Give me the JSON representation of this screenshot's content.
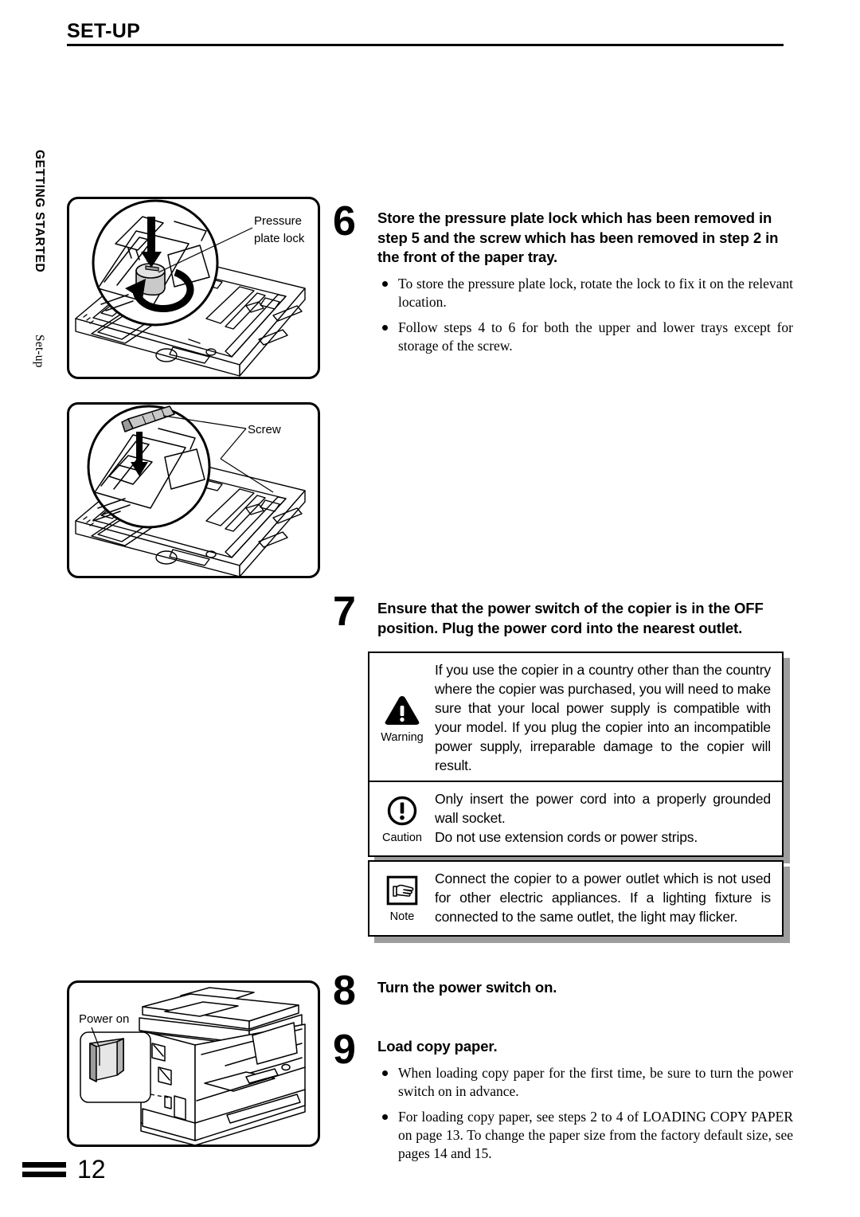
{
  "header": {
    "title": "SET-UP"
  },
  "side_tab": {
    "chapter": "GETTING STARTED",
    "section": "Set-up"
  },
  "figures": [
    {
      "id": "tray-lock",
      "name": "paper-tray-pressure-plate-lock-figure",
      "callout": "Pressure plate lock",
      "callout_line1": "Pressure",
      "callout_line2": "plate lock"
    },
    {
      "id": "tray-screw",
      "name": "paper-tray-screw-figure",
      "callout": "Screw"
    },
    {
      "id": "copier",
      "name": "copier-power-switch-figure",
      "callout": "Power on"
    }
  ],
  "steps": [
    {
      "number": "6",
      "heading": "Store the pressure plate lock which has been removed in step 5 and the screw which has been removed in step 2 in the front of the paper tray.",
      "bullets": [
        "To store the pressure plate lock, rotate the lock to fix it on the relevant location.",
        "Follow steps 4 to 6 for both the upper and lower trays except for storage of the screw."
      ]
    },
    {
      "number": "7",
      "heading": "Ensure that the power switch of the copier is in the OFF position. Plug the power cord into the nearest outlet.",
      "bullets": []
    },
    {
      "number": "8",
      "heading": "Turn the power switch on.",
      "bullets": []
    },
    {
      "number": "9",
      "heading": "Load copy paper.",
      "bullets": [
        "When loading copy paper for the first time, be sure to turn the power switch on in advance.",
        "For loading copy paper, see steps 2 to 4 of LOADING COPY PAPER on page 13. To change the paper size from the factory default size, see pages 14 and 15."
      ]
    }
  ],
  "admonitions": [
    {
      "type": "warning",
      "label": "Warning",
      "icon": "warning-triangle-icon",
      "text": "If you use the copier in a country other than the country where the copier was purchased, you will need to make sure that your local power supply is compatible with your model. If you plug the copier into an incompatible power supply, irreparable damage to the copier will result."
    },
    {
      "type": "caution",
      "label": "Caution",
      "icon": "caution-circle-icon",
      "text_line1": "Only insert the power cord into a properly grounded wall socket.",
      "text_line2": "Do not use extension cords or power strips."
    },
    {
      "type": "note",
      "label": "Note",
      "icon": "pointing-hand-icon",
      "text": "Connect the copier to a power outlet which is not used for other electric appliances. If a lighting fixture is connected to the same outlet, the light may flicker."
    }
  ],
  "footer": {
    "page_number": "12"
  },
  "colors": {
    "ink": "#000000",
    "paper": "#ffffff",
    "shadow": "#9d9d9d",
    "shade": "#d9d9d9"
  }
}
